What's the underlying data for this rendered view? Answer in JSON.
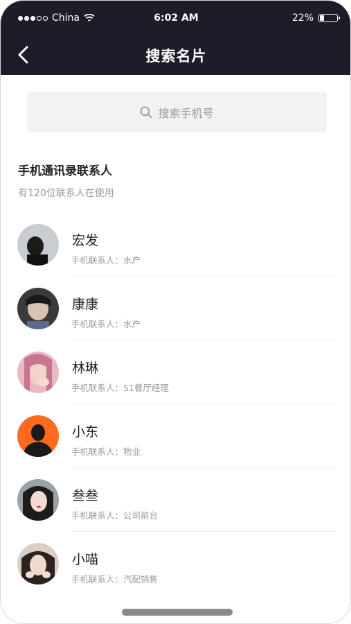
{
  "status_bar": {
    "carrier": "China",
    "time": "6:02 AM",
    "battery_percent": "22%",
    "battery_level": 0.22
  },
  "navbar": {
    "title": "搜索名片"
  },
  "search": {
    "placeholder": "搜索手机号"
  },
  "section": {
    "title": "手机通讯录联系人",
    "subtitle": "有120位联系人在使用"
  },
  "contacts": [
    {
      "name": "宏发",
      "desc": "手机联系人：水产"
    },
    {
      "name": "康康",
      "desc": "手机联系人：水产"
    },
    {
      "name": "林琳",
      "desc": "手机联系人：51餐厅经理"
    },
    {
      "name": "小东",
      "desc": "手机联系人：物业"
    },
    {
      "name": "叁叁",
      "desc": "手机联系人：公司前台"
    },
    {
      "name": "小喵",
      "desc": "手机联系人：汽配销售"
    }
  ],
  "colors": {
    "header_bg": "#1d1c29",
    "search_bg": "#f2f2f2",
    "secondary_text": "#9a9a9a",
    "avatar_orange": "#ff6a1f"
  }
}
